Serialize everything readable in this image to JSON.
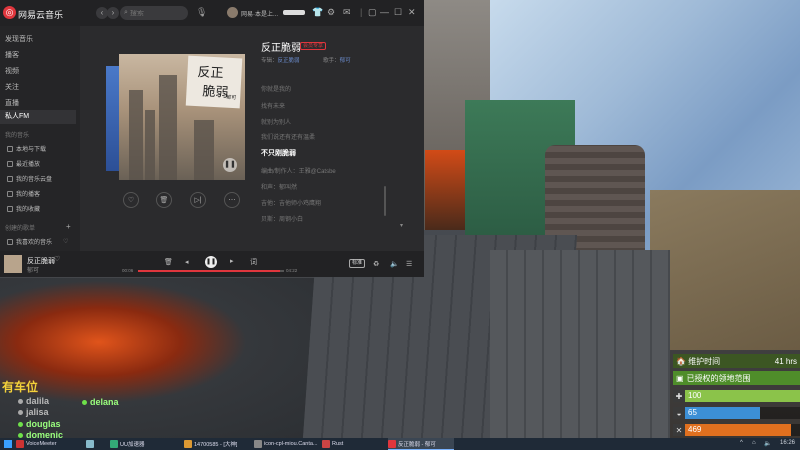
{
  "app": {
    "name": "网易云音乐",
    "search_placeholder": "搜索",
    "user_name": "网易·本是上...",
    "window_controls": [
      "minimize-icon",
      "maximize-icon",
      "close-icon"
    ]
  },
  "sidebar": {
    "top_items": [
      {
        "label": "发现音乐"
      },
      {
        "label": "播客"
      },
      {
        "label": "视频"
      },
      {
        "label": "关注"
      },
      {
        "label": "直播"
      },
      {
        "label": "私人FM",
        "active": true
      }
    ],
    "my_music_header": "我的音乐",
    "my_music_items": [
      "本地与下载",
      "最近播放",
      "我的音乐云盘",
      "我的播客",
      "我的收藏"
    ],
    "playlists_header": "创建的歌单",
    "playlists_add": "+",
    "playlists": [
      "我喜欢的音乐"
    ]
  },
  "song": {
    "title": "反正脆弱",
    "tag": "会员专享",
    "album_label": "专辑：",
    "album": "反正脆弱",
    "artist_label": "歌手：",
    "artist": "郁可",
    "cover_text_1": "反正",
    "cover_text_2": "脆弱",
    "cover_signature": "郁可",
    "lyrics": [
      {
        "text": "你就是我的"
      },
      {
        "text": "找有未来"
      },
      {
        "text": "就别为别人"
      },
      {
        "text": "我们说还有还有温柔"
      },
      {
        "text": "不只刚脆弱",
        "current": true
      },
      {
        "text": "编曲/制作人：王雅@Catsbe"
      },
      {
        "text": "和声：郁叫然"
      },
      {
        "text": "吉他：吉他师小鸡鹰翔"
      },
      {
        "text": "贝斯：周钢小白"
      }
    ]
  },
  "actions": [
    "heart-icon",
    "trash-icon",
    "next-track-icon",
    "more-icon"
  ],
  "player": {
    "title": "反正脆弱",
    "artist": "郁可",
    "time_current": "00:06",
    "time_total": "04:22",
    "progress": 0.97,
    "quality": "标准"
  },
  "game": {
    "car_title": "有车位",
    "players": [
      {
        "name": "dalila",
        "online": false
      },
      {
        "name": "jalisa",
        "online": false
      },
      {
        "name": "delana",
        "online": true
      },
      {
        "name": "douglas",
        "online": true
      },
      {
        "name": "domenic",
        "online": true
      }
    ],
    "hud": {
      "maintenance_label": "维护时间",
      "maintenance_value": "41 hrs",
      "zone_label": "已授权的领地范围",
      "bars": [
        {
          "icon": "health-icon",
          "value": "100",
          "fraction": 1.0,
          "color": "#8bc34a"
        },
        {
          "icon": "food-icon",
          "value": "65",
          "fraction": 0.65,
          "color": "#3c8fd6"
        },
        {
          "icon": "water-icon",
          "value": "469",
          "fraction": 0.92,
          "color": "#e0701f"
        }
      ]
    }
  },
  "taskbar": {
    "items": [
      {
        "label": "VoiceMeeter",
        "color": "#c33"
      },
      {
        "label": "",
        "color": "#8bc"
      },
      {
        "label": "UU加速器",
        "color": "#3a7"
      },
      {
        "label": "14700585 - [大神]",
        "color": "#d93"
      },
      {
        "label": "icon-cpl-miou.Canta...",
        "color": "#888"
      },
      {
        "label": "Rust",
        "color": "#c44"
      },
      {
        "label": "反正脆弱 - 郁可",
        "color": "#e0363d",
        "active": true
      }
    ],
    "clock": "16:26"
  }
}
